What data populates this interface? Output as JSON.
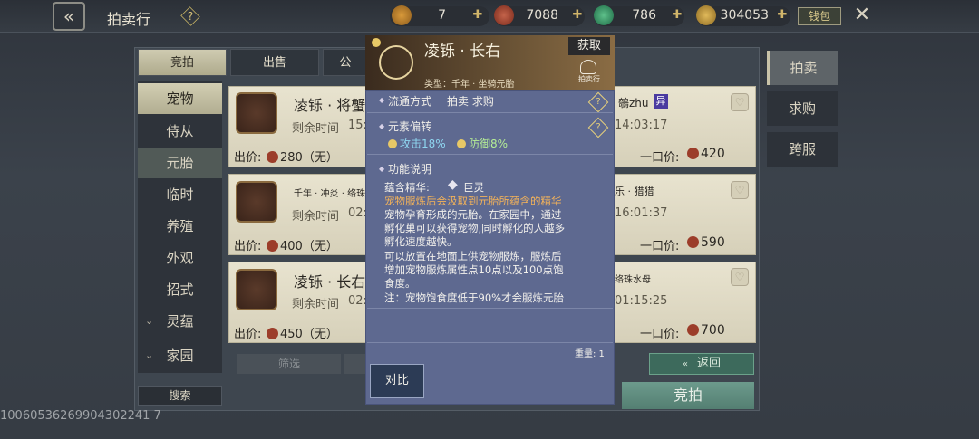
{
  "header": {
    "title": "拍卖行",
    "currencies": [
      {
        "name": "currency-1",
        "value": "7"
      },
      {
        "name": "currency-2",
        "value": "7088"
      },
      {
        "name": "currency-3",
        "value": "786"
      },
      {
        "name": "currency-4",
        "value": "304053"
      }
    ],
    "wallet_label": "钱包"
  },
  "top_tabs": [
    "竞拍",
    "出售",
    "公"
  ],
  "sidebar": {
    "items": [
      "宠物",
      "侍从",
      "元胎",
      "临时",
      "养殖",
      "外观",
      "招式",
      "灵蕴",
      "家园"
    ]
  },
  "search_label": "搜索",
  "filter_label": "筛选",
  "return_label": "返回",
  "bid_label": "竞拍",
  "right_tabs": [
    "拍卖",
    "求购",
    "跨服"
  ],
  "cards": [
    {
      "name": "凌铄 · 将蟹",
      "time_label": "剩余时间",
      "time_partial": "15:",
      "price_label": "出价:",
      "price": "280（无）"
    },
    {
      "name": "千年 · 冲炎 · 络珠",
      "time_label": "剩余时间",
      "time_partial": "02:",
      "price_label": "出价:",
      "price": "400（无）"
    },
    {
      "name": "凌铄 · 长右",
      "time_label": "剩余时间",
      "time_partial": "02:",
      "price_label": "出价:",
      "price": "450（无）"
    }
  ],
  "cards_right": [
    {
      "name": "鵸zhu",
      "badge": "异",
      "time": "14:03:17",
      "buyout_label": "一口价:",
      "buyout": "420"
    },
    {
      "name": "乐 · 猎猎",
      "time": "16:01:37",
      "buyout_label": "一口价:",
      "buyout": "590"
    },
    {
      "name": "络珠水母",
      "time": "01:15:25",
      "buyout_label": "一口价:",
      "buyout": "700"
    }
  ],
  "popup": {
    "name": "凌铄 · 长右",
    "get_label": "获取",
    "source_label": "拍卖行",
    "type": "类型：千年 · 坐骑元胎",
    "trade_label": "流通方式",
    "trade_value": "拍卖  求购",
    "element_label": "元素偏转",
    "stat_attack": "攻击18%",
    "stat_defense": "防御8%",
    "func_label": "功能说明",
    "essence_label": "蕴含精华:",
    "essence_value": "巨灵",
    "desc_orange": "宠物服炼后会汲取到元胎所蕴含的精华",
    "desc_lines": [
      "宠物孕育形成的元胎。在家园中，通过",
      "孵化巢可以获得宠物,同时孵化的人越多",
      "孵化速度越快。",
      "可以放置在地面上供宠物服炼，服炼后",
      "增加宠物服炼属性点10点以及100点饱",
      "食度。",
      "注：宠物饱食度低于90%才会服炼元胎"
    ],
    "weight": "重量: 1",
    "compare_label": "对比"
  },
  "bottom_id": "10060536269904302241 7",
  "colors": {
    "popup_bg": "#5e6990",
    "card_bg": "#e2ddc8",
    "accent_green": "#547f72"
  }
}
